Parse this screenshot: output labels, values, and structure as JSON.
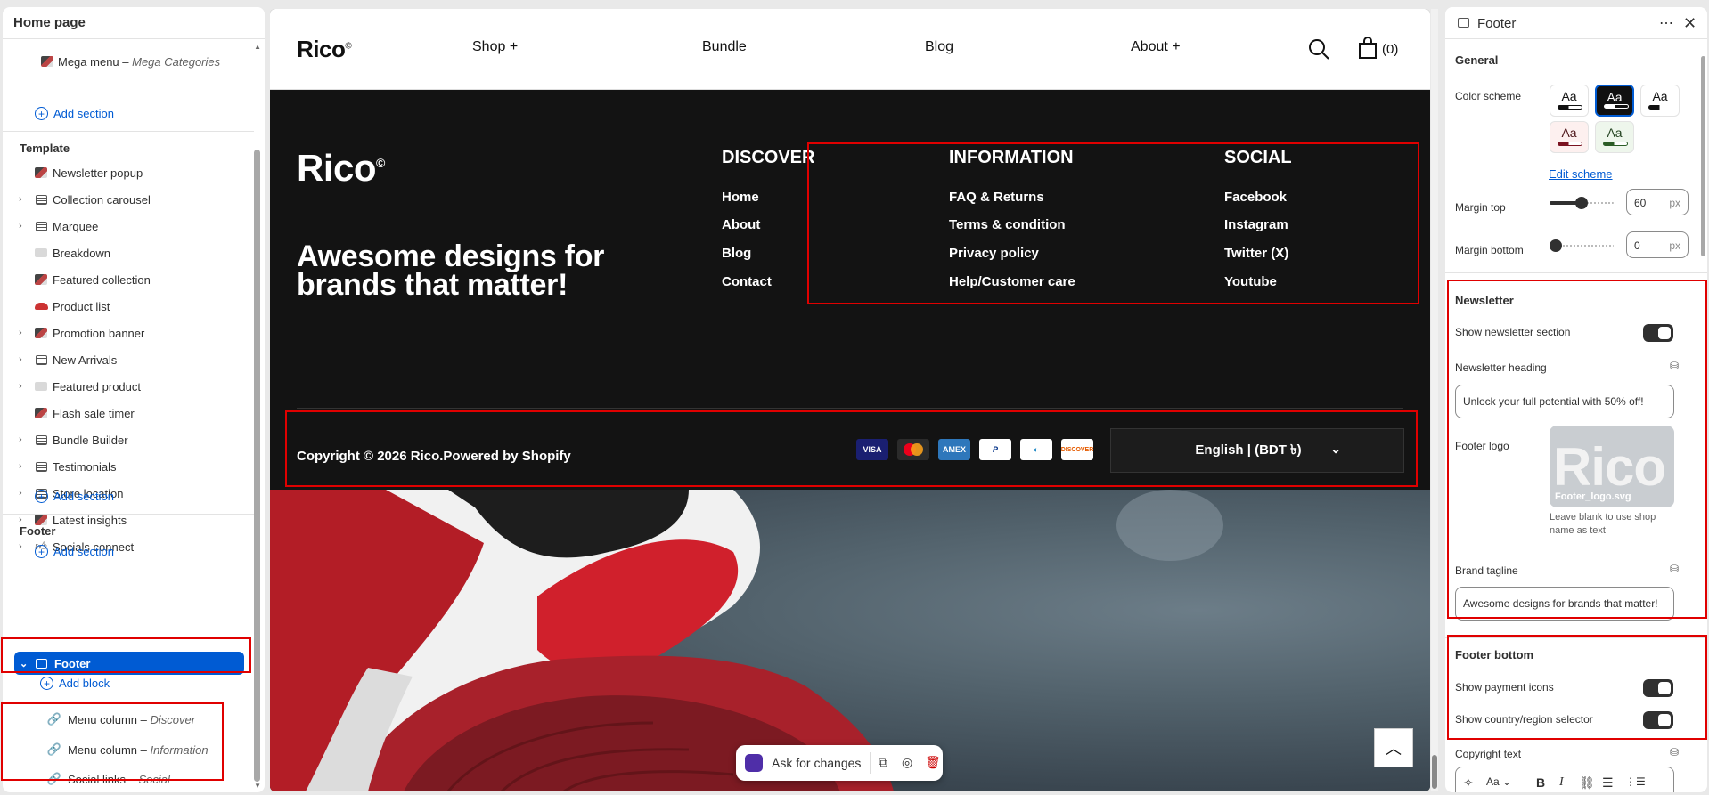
{
  "left": {
    "title": "Home page",
    "header_items": [
      {
        "label": "Mega menu",
        "sub": "Mega Categories"
      }
    ],
    "add_section_label": "Add section",
    "template_title": "Template",
    "template_items": [
      {
        "label": "Newsletter popup",
        "icon": "image-icon",
        "expandable": false
      },
      {
        "label": "Collection carousel",
        "icon": "list-icon",
        "expandable": true
      },
      {
        "label": "Marquee",
        "icon": "list-icon",
        "expandable": true
      },
      {
        "label": "Breakdown",
        "icon": "image-icon",
        "expandable": false
      },
      {
        "label": "Featured collection",
        "icon": "image-icon",
        "expandable": false
      },
      {
        "label": "Product list",
        "icon": "shoe-icon",
        "expandable": false
      },
      {
        "label": "Promotion banner",
        "icon": "image-icon",
        "expandable": true
      },
      {
        "label": "New Arrivals",
        "icon": "list-icon",
        "expandable": true
      },
      {
        "label": "Featured product",
        "icon": "image-icon",
        "expandable": true
      },
      {
        "label": "Flash sale timer",
        "icon": "image-icon",
        "expandable": false
      },
      {
        "label": "Bundle Builder",
        "icon": "list-icon",
        "expandable": true
      },
      {
        "label": "Testimonials",
        "icon": "list-icon",
        "expandable": true
      },
      {
        "label": "Store location",
        "icon": "list-icon",
        "expandable": true
      },
      {
        "label": "Latest insights",
        "icon": "image-icon",
        "expandable": true
      },
      {
        "label": "Socials connect",
        "icon": "thumb-icon",
        "expandable": true
      }
    ],
    "footer_title": "Footer",
    "footer_selected": "Footer",
    "add_block_label": "Add block",
    "footer_blocks": [
      {
        "label": "Menu column",
        "sub": "Discover"
      },
      {
        "label": "Menu column",
        "sub": "Information"
      },
      {
        "label": "Social links",
        "sub": "Social"
      }
    ]
  },
  "preview": {
    "logo": "Rico",
    "logo_mark": "©",
    "nav": [
      "Shop +",
      "Bundle",
      "Blog",
      "About +"
    ],
    "cart_count": "(0)",
    "footer_brand": "Rico",
    "footer_tagline": "Awesome designs for brands that matter!",
    "columns": [
      {
        "title": "DISCOVER",
        "links": [
          "Home",
          "About",
          "Blog",
          "Contact"
        ]
      },
      {
        "title": "INFORMATION",
        "links": [
          "FAQ & Returns",
          "Terms & condition",
          "Privacy policy",
          "Help/Customer care"
        ]
      },
      {
        "title": "SOCIAL",
        "links": [
          "Facebook",
          "Instagram",
          "Twitter (X)",
          "Youtube"
        ]
      }
    ],
    "copyright": "Copyright © 2026 Rico.Powered by Shopify",
    "payment_icons": [
      "VISA",
      "mastercard",
      "AMEX",
      "PayPal",
      "Diners",
      "DISCOVER"
    ],
    "language": "English | (BDT ৳)",
    "ask_label": "Ask for changes"
  },
  "right": {
    "title": "Footer",
    "general": "General",
    "color_scheme_label": "Color scheme",
    "swatch_text": "Aa",
    "edit_scheme": "Edit scheme",
    "margin_top_label": "Margin top",
    "margin_top": "60",
    "margin_bottom_label": "Margin bottom",
    "margin_bottom": "0",
    "unit": "px",
    "newsletter_title": "Newsletter",
    "show_newsletter": "Show newsletter section",
    "newsletter_heading_label": "Newsletter heading",
    "newsletter_heading": "Unlock your full potential with 50% off!",
    "footer_logo_label": "Footer logo",
    "logo_thumb_text": "Rico",
    "logo_file": "Footer_logo.svg",
    "logo_help": "Leave blank to use shop name as text",
    "brand_tagline_label": "Brand tagline",
    "brand_tagline": "Awesome designs for brands that matter!",
    "footer_bottom_title": "Footer bottom",
    "show_payment": "Show payment icons",
    "show_country": "Show country/region selector",
    "copyright_label": "Copyright text"
  },
  "colors": {
    "accent": "#005bd3",
    "highlight": "#e00000",
    "footer_bg": "#131313"
  }
}
